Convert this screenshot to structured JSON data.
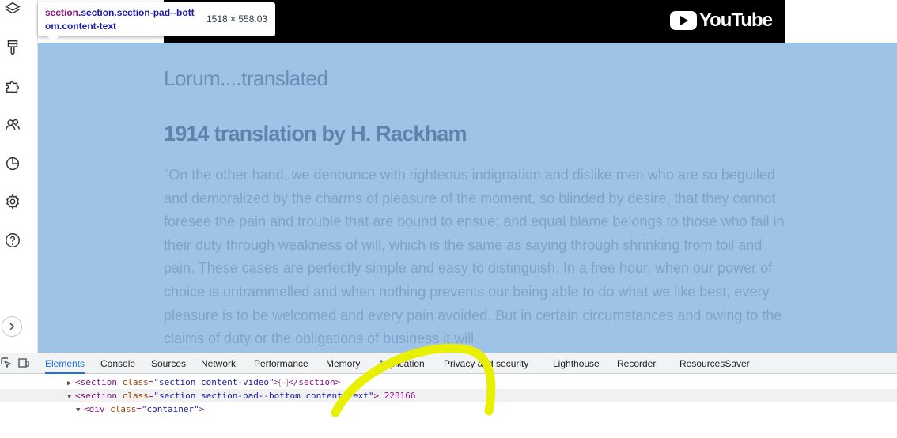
{
  "sidebar": {
    "items": [
      {
        "icon": "layers-icon"
      },
      {
        "icon": "brush-icon"
      },
      {
        "icon": "puzzle-icon"
      },
      {
        "icon": "people-icon"
      },
      {
        "icon": "pie-chart-icon"
      },
      {
        "icon": "gear-icon"
      },
      {
        "icon": "help-icon"
      }
    ],
    "expand_icon": "chevron-right-icon"
  },
  "tooltip": {
    "selector_tag": "section",
    "selector_classes": ".section.section-pad--bottom.content-text",
    "dimensions": "1518 × 558.03"
  },
  "video": {
    "logo_text": "YouTube"
  },
  "content": {
    "heading": "Lorum....translated",
    "subheading": "1914 translation by H. Rackham",
    "paragraph": "\"On the other hand, we denounce with righteous indignation and dislike men who are so beguiled and demoralized by the charms of pleasure of the moment, so blinded by desire, that they cannot foresee the pain and trouble that are bound to ensue; and equal blame belongs to those who fail in their duty through weakness of will, which is the same as saying through shrinking from toil and pain. These cases are perfectly simple and easy to distinguish. In a free hour, when our power of choice is untrammelled and when nothing prevents our being able to do what we like best, every pleasure is to be welcomed and every pain avoided. But in certain circumstances and owing to the claims of duty or the obligations of business it will"
  },
  "devtools": {
    "tabs": [
      "Elements",
      "Console",
      "Sources",
      "Network",
      "Performance",
      "Memory",
      "Application",
      "Privacy and security",
      "Lighthouse",
      "Recorder",
      "ResourcesSaver"
    ],
    "active_tab": "Elements",
    "tree": [
      {
        "tag_open": "<section",
        "attr": "class",
        "value": "\"section content-video\"",
        "close": ">",
        "ellipsis": "⋯",
        "end": "</section>"
      },
      {
        "tag_open": "<section",
        "attr": "class",
        "value": "\"section section-pad--bottom content-text\"",
        "close": ">",
        "size": "228166"
      },
      {
        "tag_open": "<div",
        "attr": "class",
        "value": "\"container\"",
        "close": ">"
      }
    ]
  },
  "colors": {
    "highlight": "#9fc3e7",
    "active_tab": "#1a73e8",
    "annotation": "#e8f000"
  }
}
